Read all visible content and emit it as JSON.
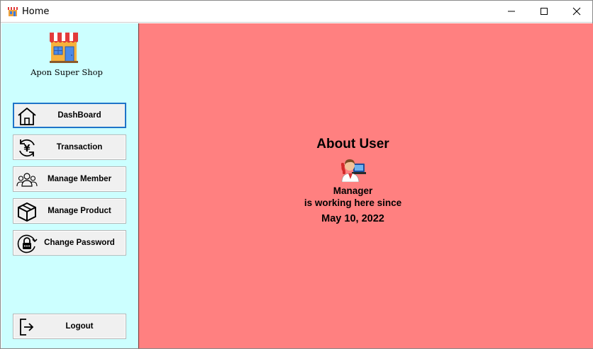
{
  "window": {
    "title": "Home",
    "title_icon": "shop-icon",
    "controls": {
      "minimize_icon": "minimize-icon",
      "maximize_icon": "maximize-icon",
      "close_icon": "close-icon"
    }
  },
  "sidebar": {
    "logo_icon": "store-icon",
    "shop_name": "Apon Super Shop",
    "background": "#ccffff",
    "items": [
      {
        "label": "DashBoard",
        "icon": "home-icon",
        "active": true
      },
      {
        "label": "Transaction",
        "icon": "yen-exchange-icon",
        "active": false
      },
      {
        "label": "Manage Member",
        "icon": "users-icon",
        "active": false
      },
      {
        "label": "Manage Product",
        "icon": "box-icon",
        "active": false
      },
      {
        "label": "Change Password",
        "icon": "lock-icon",
        "active": false
      }
    ],
    "logout": {
      "label": "Logout",
      "icon": "logout-icon"
    }
  },
  "main": {
    "background": "#ff8080",
    "title": "About User",
    "user_icon": "manager-icon",
    "role": "Manager",
    "since_text": "is working here since",
    "since_date": "May 10, 2022"
  }
}
